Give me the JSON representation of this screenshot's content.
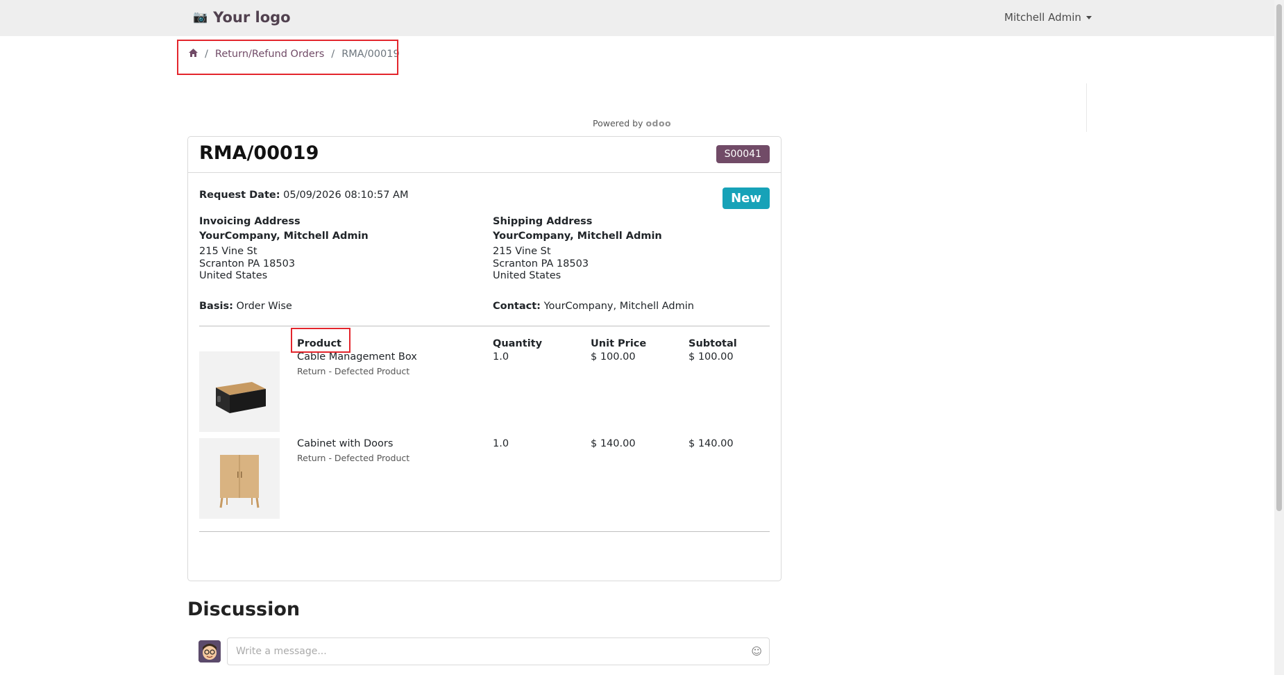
{
  "header": {
    "logo_text": "Your logo",
    "user_name": "Mitchell Admin"
  },
  "breadcrumb": {
    "items": [
      "Return/Refund Orders",
      "RMA/00019"
    ]
  },
  "powered_by": {
    "prefix": "Powered by",
    "brand": "odoo"
  },
  "rma": {
    "title": "RMA/00019",
    "sale_order_badge": "S00041",
    "state": "New",
    "request_date_label": "Request Date:",
    "request_date": "05/09/2026 08:10:57 AM",
    "invoicing": {
      "heading": "Invoicing Address",
      "name": "YourCompany, Mitchell Admin",
      "line1": "215 Vine St",
      "line2": "Scranton PA 18503",
      "line3": "United States"
    },
    "shipping": {
      "heading": "Shipping Address",
      "name": "YourCompany, Mitchell Admin",
      "line1": "215 Vine St",
      "line2": "Scranton PA 18503",
      "line3": "United States"
    },
    "basis_label": "Basis:",
    "basis": "Order Wise",
    "contact_label": "Contact:",
    "contact": "YourCompany, Mitchell Admin"
  },
  "lines": {
    "headers": [
      "Product",
      "Quantity",
      "Unit Price",
      "Subtotal"
    ],
    "rows": [
      {
        "product": "Cable Management Box",
        "reason": "Return - Defected Product",
        "quantity": "1.0",
        "unit_price": "$ 100.00",
        "subtotal": "$ 100.00"
      },
      {
        "product": "Cabinet with Doors",
        "reason": "Return - Defected Product",
        "quantity": "1.0",
        "unit_price": "$ 140.00",
        "subtotal": "$ 140.00"
      }
    ]
  },
  "discussion": {
    "title": "Discussion",
    "placeholder": "Write a message..."
  }
}
